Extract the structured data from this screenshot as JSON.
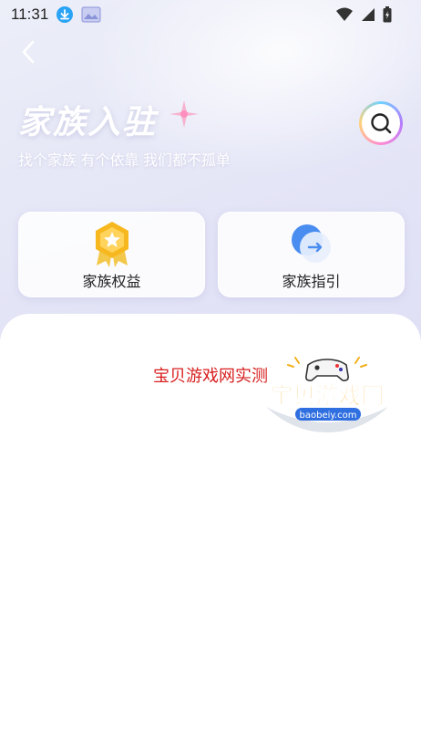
{
  "status_bar": {
    "time": "11:31",
    "icons": [
      "download-icon",
      "image-icon",
      "wifi-icon",
      "signal-icon",
      "battery-icon"
    ]
  },
  "header": {
    "back_icon": "chevron-left-icon",
    "title": "家族入驻",
    "subtitle": "找个家族 有个依靠 我们都不孤单",
    "search_icon": "search-icon"
  },
  "cards": [
    {
      "label": "家族权益",
      "icon": "medal-icon",
      "accent": "#f5b91e"
    },
    {
      "label": "家族指引",
      "icon": "guide-arrow-icon",
      "accent": "#4a8df0"
    }
  ],
  "main": {
    "watermark": "宝贝游戏网实测"
  },
  "logo": {
    "text": "宝贝游戏网",
    "url_text": "baobeiy.com"
  }
}
